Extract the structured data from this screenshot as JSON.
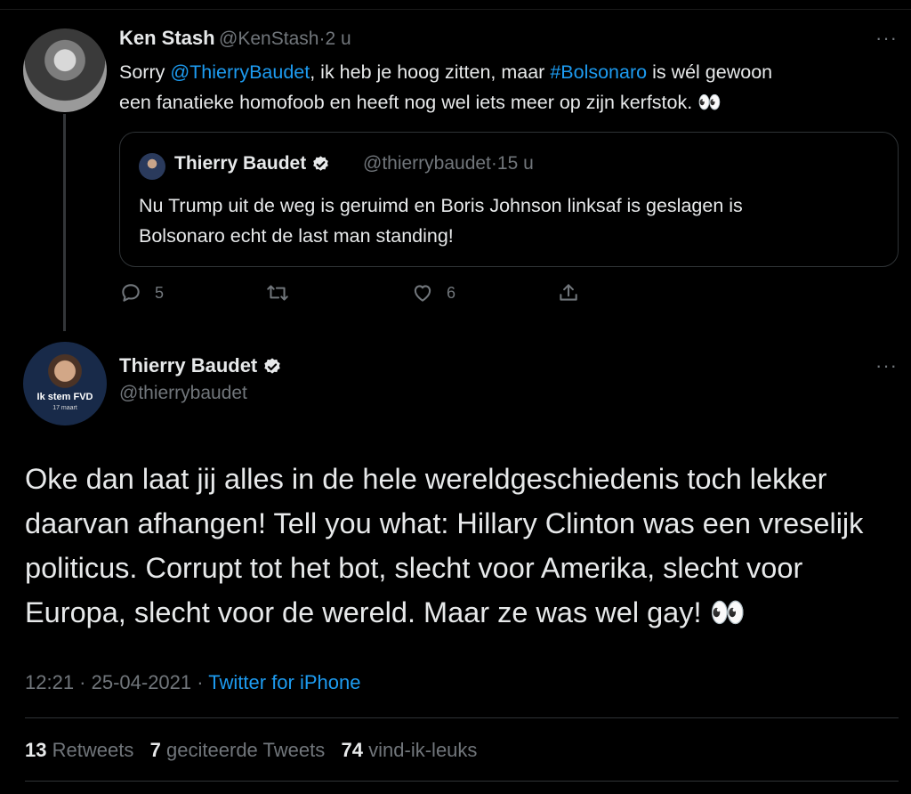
{
  "reply": {
    "name": "Ken Stash",
    "handle": "@KenStash",
    "time": "2 u",
    "text_prefix": "Sorry ",
    "mention": "@ThierryBaudet",
    "text_mid": ", ik heb je hoog zitten, maar ",
    "hashtag": "#Bolsonaro",
    "text_mid2": " is wél gewoon",
    "line2": "een fanatieke homofoob en heeft nog wel iets meer op zijn kerfstok. 👀",
    "reply_count": "5",
    "like_count": "6"
  },
  "quoted": {
    "name": "Thierry Baudet",
    "handle": "@thierrybaudet",
    "time": "15 u",
    "line1": "Nu Trump uit de weg is geruimd en Boris Johnson linksaf is geslagen is",
    "line2": "Bolsonaro echt de last man standing!"
  },
  "main": {
    "name": "Thierry Baudet",
    "handle": "@thierrybaudet",
    "avatar_badge": "Ik stem FVD",
    "avatar_badge_sub": "17 maart",
    "line1": "Oke dan laat jij alles in de hele wereldgeschiedenis toch lekker",
    "line2": "daarvan afhangen! Tell you what: Hillary Clinton was een vreselijk",
    "line3": "politicus. Corrupt tot het bot, slecht voor Amerika, slecht voor",
    "line4": "Europa, slecht voor de wereld. Maar ze was wel gay! 👀",
    "timestamp": "12:21 · 25-04-2021 · ",
    "source": "Twitter for iPhone",
    "retweets": "13",
    "retweets_label": "Retweets",
    "quotes": "7",
    "quotes_label": "geciteerde Tweets",
    "likes": "74",
    "likes_label": "vind-ik-leuks"
  },
  "ui": {
    "more": "···",
    "dot": "·",
    "accent": "#1d9bf0",
    "muted": "#71767b",
    "background": "#000000"
  }
}
